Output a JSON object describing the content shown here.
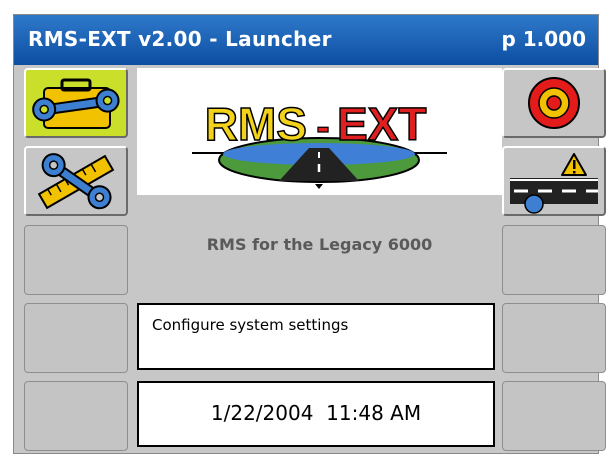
{
  "window": {
    "title": "RMS-EXT v2.00 - Launcher",
    "page_indicator": "p 1.000"
  },
  "logo": {
    "text_part1": "RMS",
    "text_dash": "-",
    "text_part2": "EXT"
  },
  "subtitle": "RMS for the Legacy 6000",
  "status_text": "Configure system settings",
  "datetime": {
    "date": "1/22/2004",
    "time": "11:48 AM"
  },
  "buttons": {
    "left": [
      {
        "icon": "toolbox-wrench-icon",
        "active": true
      },
      {
        "icon": "wrench-ruler-icon",
        "active": false
      },
      {
        "icon": "",
        "active": false
      },
      {
        "icon": "",
        "active": false
      },
      {
        "icon": "",
        "active": false
      }
    ],
    "right": [
      {
        "icon": "target-icon",
        "active": false
      },
      {
        "icon": "road-warning-icon",
        "active": false
      },
      {
        "icon": "",
        "active": false
      },
      {
        "icon": "",
        "active": false
      },
      {
        "icon": "",
        "active": false
      }
    ]
  },
  "colors": {
    "titlebar": "#1b5fb4",
    "active_button": "#c9df2a",
    "frame_bg": "#c7c7c7"
  }
}
